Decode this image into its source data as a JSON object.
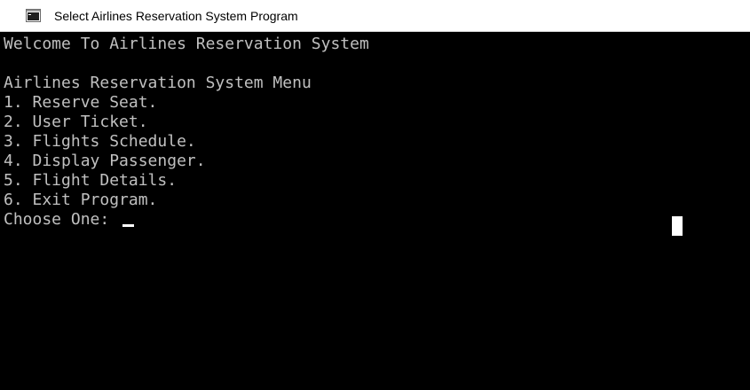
{
  "window": {
    "title": "Select Airlines Reservation System Program",
    "icon": "console-app-icon"
  },
  "console": {
    "lines": [
      "Welcome To Airlines Reservation System",
      "",
      "Airlines Reservation System Menu",
      "1. Reserve Seat.",
      "2. User Ticket.",
      "3. Flights Schedule.",
      "4. Display Passenger.",
      "5. Flight Details.",
      "6. Exit Program.",
      "Choose One: "
    ]
  },
  "colors": {
    "console_background": "#000000",
    "console_text": "#c0c0c0",
    "titlebar_background": "#ffffff",
    "cursor": "#ffffff"
  }
}
